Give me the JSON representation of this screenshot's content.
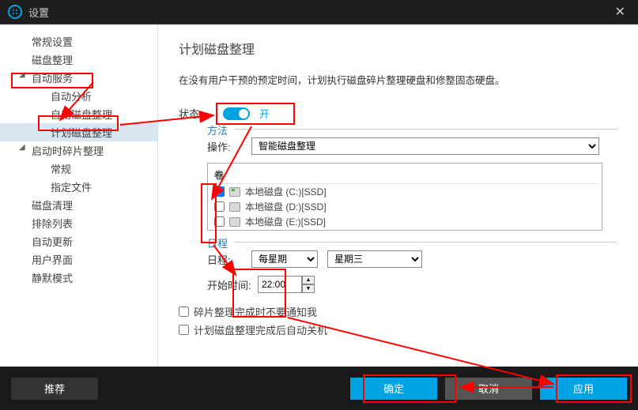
{
  "window": {
    "title": "设置"
  },
  "sidebar": {
    "items": [
      {
        "label": "常规设置",
        "level": "top",
        "expand": ""
      },
      {
        "label": "磁盘整理",
        "level": "top",
        "expand": ""
      },
      {
        "label": "自动服务",
        "level": "top",
        "expand": "◢"
      },
      {
        "label": "自动分析",
        "level": "sub",
        "expand": ""
      },
      {
        "label": "自动磁盘整理",
        "level": "sub",
        "expand": ""
      },
      {
        "label": "计划磁盘整理",
        "level": "sub",
        "expand": "",
        "selected": true
      },
      {
        "label": "启动时碎片整理",
        "level": "top",
        "expand": "◢"
      },
      {
        "label": "常规",
        "level": "sub",
        "expand": ""
      },
      {
        "label": "指定文件",
        "level": "sub",
        "expand": ""
      },
      {
        "label": "磁盘清理",
        "level": "top",
        "expand": ""
      },
      {
        "label": "排除列表",
        "level": "top",
        "expand": ""
      },
      {
        "label": "自动更新",
        "level": "top",
        "expand": ""
      },
      {
        "label": "用户界面",
        "level": "top",
        "expand": ""
      },
      {
        "label": "静默模式",
        "level": "top",
        "expand": ""
      }
    ]
  },
  "content": {
    "title": "计划磁盘整理",
    "desc": "在没有用户干预的预定时间，计划执行磁盘碎片整理硬盘和修整固态硬盘。",
    "state_label": "状态:",
    "toggle_label": "开",
    "method": {
      "legend": "方法",
      "action_label": "操作:",
      "action_value": "智能磁盘整理",
      "vol_header": "卷",
      "volumes": [
        {
          "name": "本地磁盘 (C:)[SSD]",
          "checked": true,
          "ssd": true
        },
        {
          "name": "本地磁盘 (D:)[SSD]",
          "checked": false,
          "ssd": false
        },
        {
          "name": "本地磁盘 (E:)[SSD]",
          "checked": false,
          "ssd": false
        }
      ]
    },
    "schedule": {
      "legend": "日程",
      "date_label": "日程:",
      "freq": "每星期",
      "day": "星期三",
      "time_label": "开始时间:",
      "time_value": "22:00"
    },
    "opts": {
      "no_notify": "碎片整理完成时不要通知我",
      "shutdown": "计划磁盘整理完成后自动关机"
    }
  },
  "footer": {
    "recommend": "推荐",
    "ok": "确定",
    "cancel": "取消",
    "apply": "应用"
  }
}
